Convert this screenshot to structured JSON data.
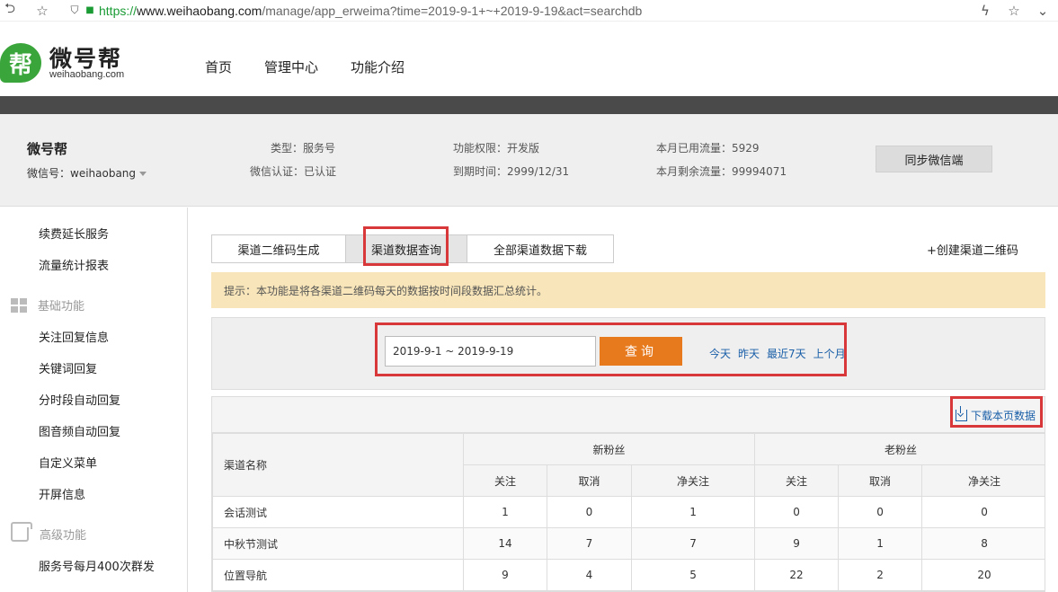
{
  "browser": {
    "url_proto": "https://",
    "url_host": "www.weihaobang.com",
    "url_path": "/manage/app_erweima?time=2019-9-1+~+2019-9-19&act=searchdb"
  },
  "header": {
    "logo_glyph": "帮",
    "logo_name": "微号帮",
    "logo_domain": "weihaobang.com",
    "nav": [
      "首页",
      "管理中心",
      "功能介绍"
    ]
  },
  "account": {
    "name": "微号帮",
    "wechat_id": "微信号：weihaobang",
    "type": "类型：服务号",
    "verified": "微信认证：已认证",
    "permission": "功能权限：开发版",
    "expire": "到期时间：2999/12/31",
    "used_traffic": "本月已用流量：5929",
    "remaining_traffic": "本月剩余流量：99994071",
    "sync_button": "同步微信端"
  },
  "sidebar": {
    "top_items": [
      "续费延长服务",
      "流量统计报表"
    ],
    "group_basic": "基础功能",
    "basic_items": [
      "关注回复信息",
      "关键词回复",
      "分时段自动回复",
      "图音频自动回复",
      "自定义菜单",
      "开屏信息"
    ],
    "group_advanced": "高级功能",
    "advanced_items": [
      "服务号每月400次群发"
    ]
  },
  "main": {
    "tabs": [
      "渠道二维码生成",
      "渠道数据查询",
      "全部渠道数据下载"
    ],
    "create_link": "+创建渠道二维码",
    "tip": "提示：本功能是将各渠道二维码每天的数据按时间段数据汇总统计。",
    "date_range": "2019-9-1 ~ 2019-9-19",
    "query_button": "查询",
    "quick_links": [
      "今天",
      "昨天",
      "最近7天",
      "上个月"
    ],
    "download_link": "下载本页数据"
  },
  "table": {
    "col_name": "渠道名称",
    "group_new": "新粉丝",
    "group_old": "老粉丝",
    "sub_headers": [
      "关注",
      "取消",
      "净关注",
      "关注",
      "取消",
      "净关注"
    ],
    "rows": [
      {
        "name": "会话测试",
        "values": [
          "1",
          "0",
          "1",
          "0",
          "0",
          "0"
        ]
      },
      {
        "name": "中秋节测试",
        "values": [
          "14",
          "7",
          "7",
          "9",
          "1",
          "8"
        ]
      },
      {
        "name": "位置导航",
        "values": [
          "9",
          "4",
          "5",
          "22",
          "2",
          "20"
        ]
      }
    ]
  },
  "colors": {
    "accent_orange": "#e87a1e",
    "highlight_red": "#d9383b",
    "link_blue": "#1a5fa8",
    "tip_background": "#f8e5b9"
  }
}
